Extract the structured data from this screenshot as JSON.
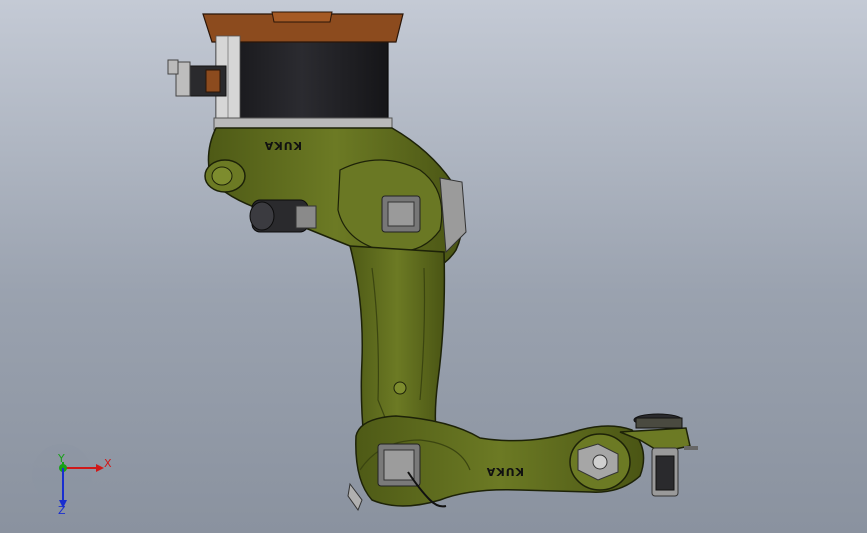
{
  "viewport": {
    "brand_text_upper": "KUKA",
    "brand_text_lower": "KUKA"
  },
  "triad": {
    "x_label": "X",
    "y_label": "Y",
    "z_label": "Z"
  },
  "colors": {
    "background_top": "#c4cad5",
    "background_bottom": "#8a929f",
    "robot_body": "#5c6a1e",
    "robot_body_light": "#7b8a2c",
    "robot_outline": "#1d2208",
    "base_dark": "#1f1f22",
    "base_cap": "#8a4a1c",
    "axis_x": "#d01818",
    "axis_y": "#18a018",
    "axis_z": "#1a2fd0"
  }
}
